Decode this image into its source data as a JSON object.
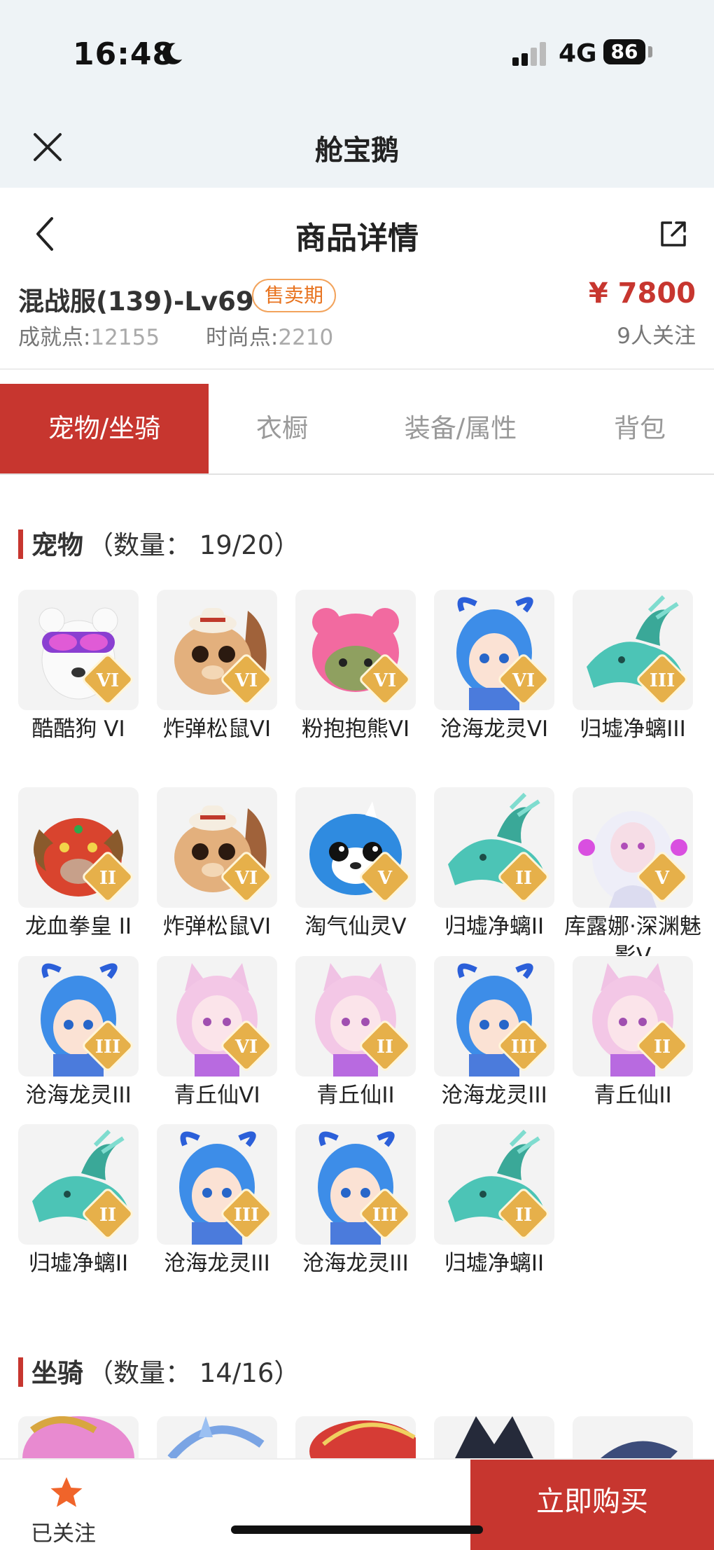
{
  "status": {
    "time": "16:48",
    "network": "4G",
    "battery": "86"
  },
  "app": {
    "title": "舱宝鹅"
  },
  "header": {
    "title": "商品详情"
  },
  "product": {
    "name": "混战服(139)-Lv69",
    "badge": "售卖期",
    "achievement_label": "成就点:",
    "achievement_value": "12155",
    "fashion_label": "时尚点:",
    "fashion_value": "2210",
    "price": "¥ 7800",
    "followers": "9人关注"
  },
  "tabs": [
    {
      "label": "宠物/坐骑",
      "active": true
    },
    {
      "label": "衣橱",
      "active": false
    },
    {
      "label": "装备/属性",
      "active": false
    },
    {
      "label": "背包",
      "active": false
    }
  ],
  "pets_section": {
    "name": "宠物",
    "count": "（数量：  19/20）"
  },
  "pets": [
    {
      "label": "酷酷狗 VI",
      "icon": "bear-goggles",
      "tier": "VI"
    },
    {
      "label": "炸弹松鼠VI",
      "icon": "squirrel",
      "tier": "VI"
    },
    {
      "label": "粉抱抱熊VI",
      "icon": "pink-bear",
      "tier": "VI"
    },
    {
      "label": "沧海龙灵VI",
      "icon": "dragon-girl",
      "tier": "VI"
    },
    {
      "label": "归墟净螭III",
      "icon": "sea-dragon",
      "tier": "III"
    },
    {
      "label": "龙血拳皇 II",
      "icon": "ram-beast",
      "tier": "II"
    },
    {
      "label": "炸弹松鼠VI",
      "icon": "squirrel",
      "tier": "VI"
    },
    {
      "label": "淘气仙灵V",
      "icon": "blue-pup",
      "tier": "V"
    },
    {
      "label": "归墟净螭II",
      "icon": "sea-dragon",
      "tier": "II"
    },
    {
      "label": "库露娜·深渊魅影V",
      "icon": "white-fairy",
      "tier": "V"
    },
    {
      "label": "沧海龙灵III",
      "icon": "dragon-girl",
      "tier": "III"
    },
    {
      "label": "青丘仙VI",
      "icon": "fox-girl",
      "tier": "VI"
    },
    {
      "label": "青丘仙II",
      "icon": "fox-girl",
      "tier": "II"
    },
    {
      "label": "沧海龙灵III",
      "icon": "dragon-girl",
      "tier": "III"
    },
    {
      "label": "青丘仙II",
      "icon": "fox-girl",
      "tier": "II"
    },
    {
      "label": "归墟净螭II",
      "icon": "sea-dragon",
      "tier": "II"
    },
    {
      "label": "沧海龙灵III",
      "icon": "dragon-girl",
      "tier": "III"
    },
    {
      "label": "沧海龙灵III",
      "icon": "dragon-girl",
      "tier": "III"
    },
    {
      "label": "归墟净螭II",
      "icon": "sea-dragon",
      "tier": "II"
    }
  ],
  "mounts_section": {
    "name": "坐骑",
    "count": "（数量：  14/16）"
  },
  "mounts": [
    {
      "icon": "pink-mount"
    },
    {
      "icon": "ice-mount"
    },
    {
      "icon": "red-mount"
    },
    {
      "icon": "dark-mount"
    },
    {
      "icon": "shark-mount"
    }
  ],
  "bottom": {
    "follow_label": "已关注",
    "buy_label": "立即购买"
  },
  "colors": {
    "accent": "#c7362f",
    "badge": "#e8731f",
    "star": "#f0642a"
  }
}
